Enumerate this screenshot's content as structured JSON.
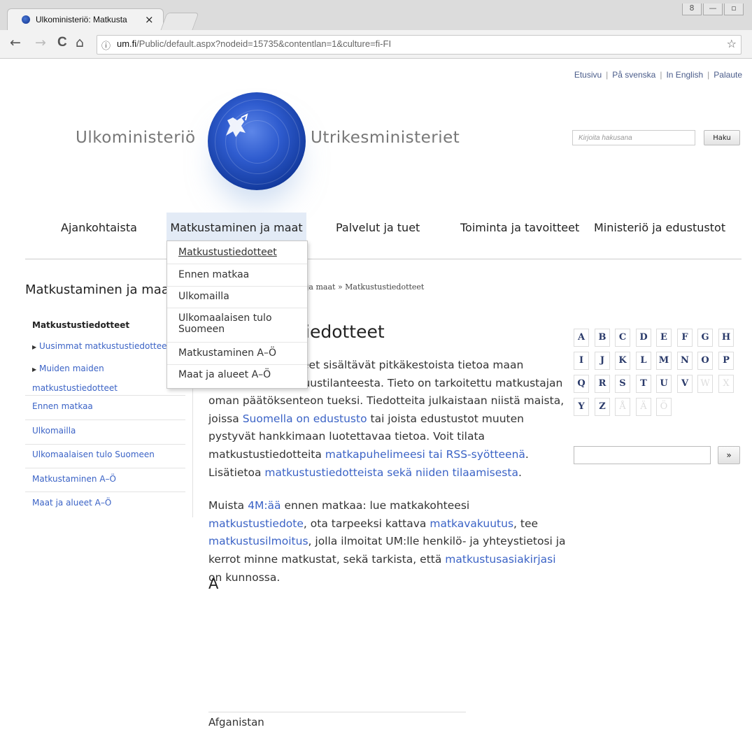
{
  "browser": {
    "tab_title": "Ulkoministeriö: Matkusta",
    "tab_close": "×",
    "url_host": "um.fi",
    "url_path": "/Public/default.aspx?nodeid=15735&contentlan=1&culture=fi-FI",
    "back": "←",
    "forward": "→",
    "reload": "C",
    "home": "⌂",
    "info": "ⓘ",
    "star": "☆",
    "winctrl_user": "8",
    "winctrl_min": "—",
    "winctrl_max": "▫"
  },
  "top_links": {
    "home": "Etusivu",
    "swedish": "På svenska",
    "english": "In English",
    "feedback": "Palaute",
    "separator": "|"
  },
  "header": {
    "brand_fi": "Ulkoministeriö",
    "brand_sv": "Utrikesministeriet",
    "search_placeholder": "Kirjoita hakusana",
    "search_button": "Haku"
  },
  "main_nav": [
    {
      "label": "Ajankohtaista"
    },
    {
      "label": "Matkustaminen ja maat"
    },
    {
      "label": "Palvelut ja tuet"
    },
    {
      "label": "Toiminta ja tavoitteet"
    },
    {
      "label": "Ministeriö ja edustustot"
    }
  ],
  "dropdown": [
    {
      "label": "Matkustustiedotteet"
    },
    {
      "label": "Ennen matkaa"
    },
    {
      "label": "Ulkomailla"
    },
    {
      "label": "Ulkomaalaisen tulo Suomeen"
    },
    {
      "label": "Matkustaminen A–Ö"
    },
    {
      "label": "Maat ja alueet A–Ö"
    }
  ],
  "sidebar": {
    "title": "Matkustaminen ja maat",
    "current": "Matkustustiedotteet",
    "sub_items": [
      {
        "label": "Uusimmat matkustustiedotteet"
      },
      {
        "label": "Muiden maiden matkustustiedotteet"
      }
    ],
    "items": [
      {
        "label": "Ennen matkaa"
      },
      {
        "label": "Ulkomailla"
      },
      {
        "label": "Ulkomaalaisen tulo Suomeen"
      },
      {
        "label": "Matkustaminen A–Ö"
      },
      {
        "label": "Maat ja alueet A–Ö"
      }
    ]
  },
  "breadcrumb": {
    "visible_part": "ja maat",
    "arrow": "»",
    "current": "Matkustustiedotteet"
  },
  "content": {
    "title_visible": "iedotteet",
    "p1": {
      "t1": "eet sisältävät pitkäkestoista tietoa maan",
      "t2": "yleisestä turvallisuustilanteesta. Tieto on tarkoitettu matkustajan oman päätöksenteon tueksi. Tiedotteita julkaistaan niistä maista, joissa ",
      "link1": "Suomella on edustusto",
      "t3": " tai joista edustustot muuten pystyvät hankkimaan luotettavaa tietoa. Voit tilata matkustustiedotteita ",
      "link2": "matkapuhelimeesi tai RSS-syötteenä",
      "t4": ". Lisätietoa ",
      "link3": "matkustustiedotteista sekä niiden tilaamisesta",
      "t5": "."
    },
    "p2": {
      "t1": "Muista ",
      "link1": "4M:ää",
      "t2": " ennen matkaa: lue matkakohteesi ",
      "link2": "matkustustiedote",
      "t3": ", ota tarpeeksi kattava ",
      "link3": "matkavakuutus",
      "t4": ", tee ",
      "link4": "matkustusilmoitus",
      "t5": ", jolla ilmoitat UM:lle henkilö- ja yhteystietosi ja kerrot minne matkustat, sekä tarkista, että ",
      "link5": "matkustusasiakirjasi",
      "t6": " on kunnossa."
    },
    "letter_heading": "A",
    "first_country": "Afganistan"
  },
  "alphabet": {
    "letters": [
      {
        "l": "A",
        "enabled": true
      },
      {
        "l": "B",
        "enabled": true
      },
      {
        "l": "C",
        "enabled": true
      },
      {
        "l": "D",
        "enabled": true
      },
      {
        "l": "E",
        "enabled": true
      },
      {
        "l": "F",
        "enabled": true
      },
      {
        "l": "G",
        "enabled": true
      },
      {
        "l": "H",
        "enabled": true
      },
      {
        "l": "I",
        "enabled": true
      },
      {
        "l": "J",
        "enabled": true
      },
      {
        "l": "K",
        "enabled": true
      },
      {
        "l": "L",
        "enabled": true
      },
      {
        "l": "M",
        "enabled": true
      },
      {
        "l": "N",
        "enabled": true
      },
      {
        "l": "O",
        "enabled": true
      },
      {
        "l": "P",
        "enabled": true
      },
      {
        "l": "Q",
        "enabled": true
      },
      {
        "l": "R",
        "enabled": true
      },
      {
        "l": "S",
        "enabled": true
      },
      {
        "l": "T",
        "enabled": true
      },
      {
        "l": "U",
        "enabled": true
      },
      {
        "l": "V",
        "enabled": true
      },
      {
        "l": "W",
        "enabled": false
      },
      {
        "l": "X",
        "enabled": false
      },
      {
        "l": "Y",
        "enabled": true
      },
      {
        "l": "Z",
        "enabled": true
      },
      {
        "l": "Å",
        "enabled": false
      },
      {
        "l": "Ä",
        "enabled": false
      },
      {
        "l": "Ö",
        "enabled": false
      }
    ],
    "go_button": "»"
  },
  "colors": {
    "link": "#3b63c6",
    "nav_active_bg": "#e3ebf6",
    "logo_blue": "#1f4bb8"
  }
}
